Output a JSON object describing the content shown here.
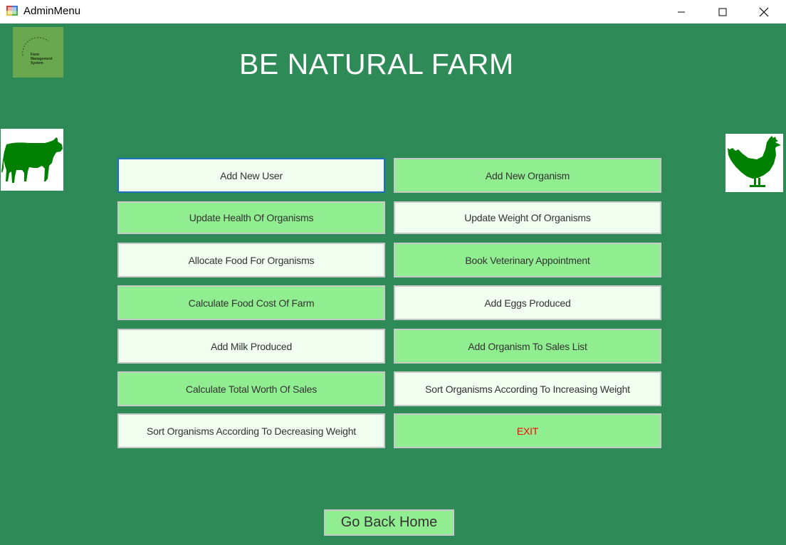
{
  "window": {
    "title": "AdminMenu",
    "icons": [
      "app-icon",
      "minimize-icon",
      "maximize-icon",
      "close-icon"
    ]
  },
  "header": {
    "title": "BE NATURAL FARM",
    "logo_text": [
      "Farm",
      "Management",
      "System"
    ]
  },
  "menu": {
    "buttons": [
      {
        "label": "Add New User",
        "style": "light",
        "focused": true
      },
      {
        "label": "Add New Organism",
        "style": "green"
      },
      {
        "label": "Update Health Of Organisms",
        "style": "green"
      },
      {
        "label": "Update Weight Of Organisms",
        "style": "light"
      },
      {
        "label": "Allocate Food For Organisms",
        "style": "light"
      },
      {
        "label": "Book Veterinary Appointment",
        "style": "green"
      },
      {
        "label": "Calculate Food Cost Of Farm",
        "style": "green"
      },
      {
        "label": "Add Eggs Produced",
        "style": "light"
      },
      {
        "label": "Add Milk Produced",
        "style": "light"
      },
      {
        "label": "Add Organism To Sales List",
        "style": "green"
      },
      {
        "label": "Calculate Total Worth Of Sales",
        "style": "green"
      },
      {
        "label": "Sort Organisms According To Increasing Weight",
        "style": "light"
      },
      {
        "label": "Sort Organisms According To Decreasing Weight",
        "style": "light"
      },
      {
        "label": "EXIT",
        "style": "green"
      }
    ]
  },
  "footer": {
    "home_label": "Go Back Home"
  },
  "colors": {
    "background": "#2e8b57",
    "button_green": "#90ee90",
    "button_light": "#f0fff0",
    "exit_text": "#ff0000",
    "animal": "#008000"
  }
}
